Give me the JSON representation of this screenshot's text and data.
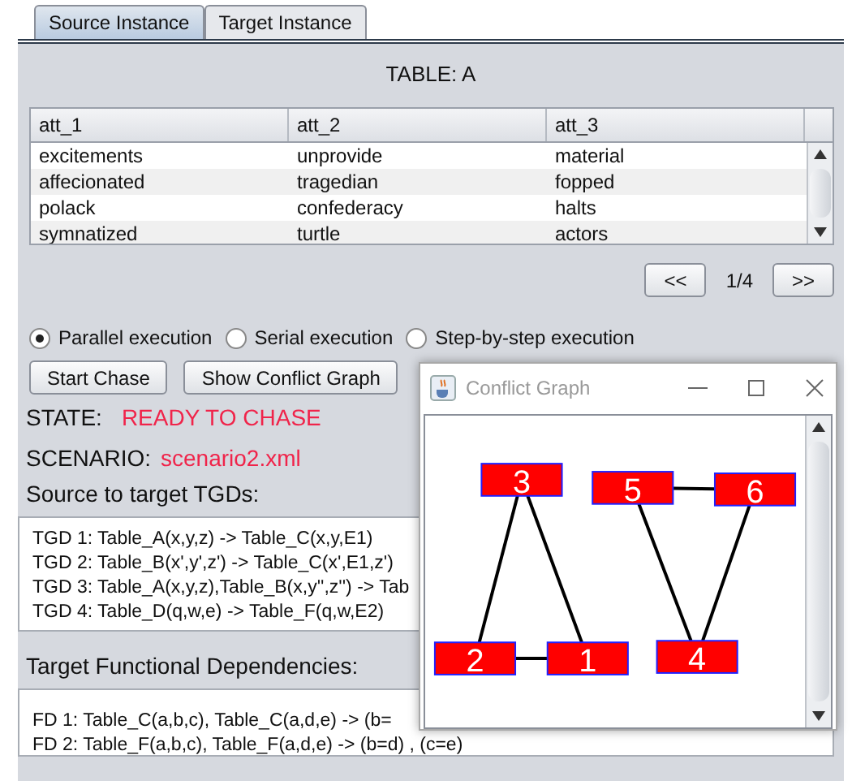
{
  "tabs": [
    {
      "label": "Source Instance",
      "selected": true
    },
    {
      "label": "Target Instance",
      "selected": false
    }
  ],
  "table_title": "TABLE: A",
  "table": {
    "columns": [
      "att_1",
      "att_2",
      "att_3"
    ],
    "rows": [
      [
        "excitements",
        "unprovide",
        "material"
      ],
      [
        "affecionated",
        "tragedian",
        "fopped"
      ],
      [
        "polack",
        "confederacy",
        "halts"
      ],
      [
        "symnatized",
        "turtle",
        "actors"
      ]
    ]
  },
  "pager": {
    "prev": "<<",
    "page": "1/4",
    "next": ">>"
  },
  "execution_modes": [
    {
      "label": "Parallel execution",
      "selected": true
    },
    {
      "label": "Serial execution",
      "selected": false
    },
    {
      "label": "Step-by-step execution",
      "selected": false
    }
  ],
  "buttons": [
    "Start Chase",
    "Show Conflict Graph"
  ],
  "state": {
    "label": "STATE:",
    "value": "READY TO CHASE"
  },
  "scenario": {
    "label": "SCENARIO:",
    "value": "scenario2.xml"
  },
  "tgds": {
    "heading": "Source to target TGDs:",
    "lines": [
      "TGD 1: Table_A(x,y,z) -> Table_C(x,y,E1)",
      "TGD 2: Table_B(x',y',z') -> Table_C(x',E1,z')",
      "TGD 3: Table_A(x,y,z),Table_B(x,y'',z'') -> Tab",
      "TGD 4: Table_D(q,w,e) -> Table_F(q,w,E2)"
    ]
  },
  "fds": {
    "heading": "Target Functional Dependencies:",
    "lines": [
      "FD 1: Table_C(a,b,c), Table_C(a,d,e) -> (b=",
      "FD 2: Table_F(a,b,c), Table_F(a,d,e) -> (b=d) , (c=e)"
    ]
  },
  "conflict_window": {
    "title": "Conflict Graph",
    "nodes": [
      {
        "label": "3"
      },
      {
        "label": "5"
      },
      {
        "label": "6"
      },
      {
        "label": "2"
      },
      {
        "label": "1"
      },
      {
        "label": "4"
      }
    ]
  }
}
